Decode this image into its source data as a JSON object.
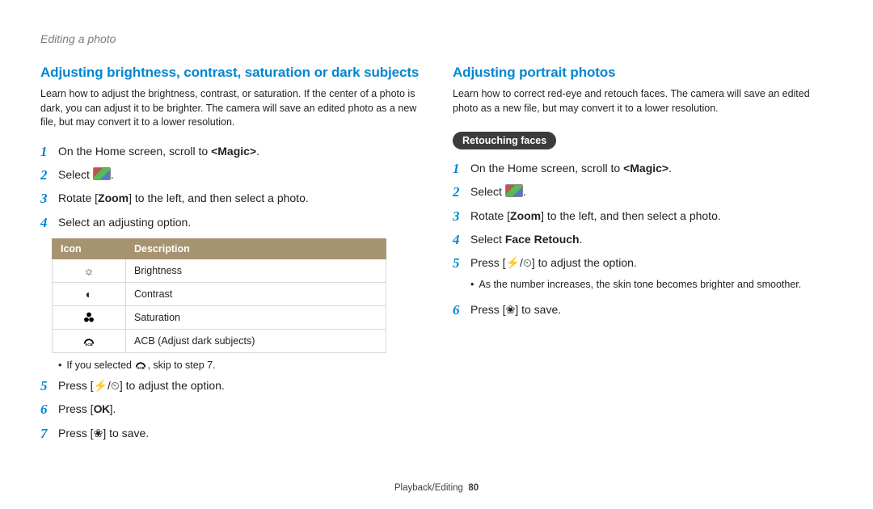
{
  "breadcrumb": "Editing a photo",
  "footer": {
    "section": "Playback/Editing",
    "page": "80"
  },
  "left": {
    "title": "Adjusting brightness, contrast, saturation or dark subjects",
    "intro": "Learn how to adjust the brightness, contrast, or saturation. If the center of a photo is dark, you can adjust it to be brighter. The camera will save an edited photo as a new file, but may convert it to a lower resolution.",
    "steps": {
      "s1a": "On the Home screen, scroll to ",
      "s1b": "<Magic>",
      "s1c": ".",
      "s2a": "Select ",
      "s2b": ".",
      "s3a": "Rotate [",
      "s3b": "Zoom",
      "s3c": "] to the left, and then select a photo.",
      "s4": "Select an adjusting option.",
      "s5a": "Press [",
      "s5b": "/",
      "s5c": "] to adjust the option.",
      "s6a": "Press [",
      "s6b": "].",
      "s7a": "Press [",
      "s7b": "] to save."
    },
    "table": {
      "h1": "Icon",
      "h2": "Description",
      "rows": [
        {
          "desc": "Brightness"
        },
        {
          "desc": "Contrast"
        },
        {
          "desc": "Saturation"
        },
        {
          "desc": "ACB (Adjust dark subjects)"
        }
      ]
    },
    "note_a": "If you selected ",
    "note_b": ", skip to step 7."
  },
  "right": {
    "title": "Adjusting portrait photos",
    "intro": "Learn how to correct red-eye and retouch faces. The camera will save an edited photo as a new file, but may convert it to a lower resolution.",
    "pill": "Retouching faces",
    "steps": {
      "s1a": "On the Home screen, scroll to ",
      "s1b": "<Magic>",
      "s1c": ".",
      "s2a": "Select ",
      "s2b": ".",
      "s3a": "Rotate [",
      "s3b": "Zoom",
      "s3c": "] to the left, and then select a photo.",
      "s4a": "Select ",
      "s4b": "Face Retouch",
      "s4c": ".",
      "s5a": "Press [",
      "s5b": "/",
      "s5c": "] to adjust the option.",
      "s5note": "As the number increases, the skin tone becomes brighter and smoother.",
      "s6a": "Press [",
      "s6b": "] to save."
    }
  }
}
